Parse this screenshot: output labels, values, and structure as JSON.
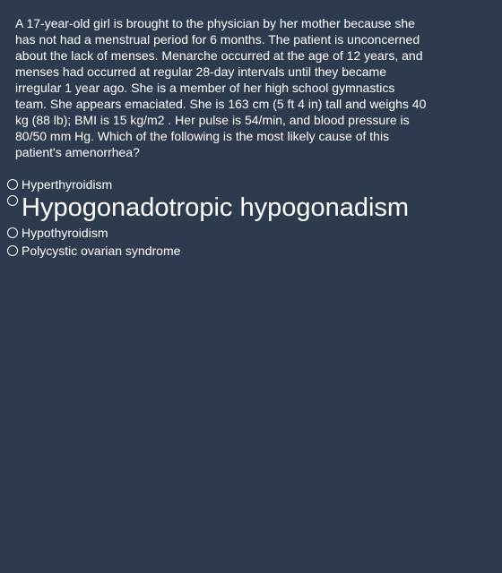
{
  "question": {
    "stem": "A 17-year-old girl is brought to the physician by her mother because she has not had a menstrual period for 6 months. The patient is unconcerned about the lack of menses. Menarche occurred at the age of 12 years, and menses had occurred at regular 28-day intervals until they became irregular 1 year ago. She is a member of her high school gymnastics team. She appears emaciated. She is 163 cm (5 ft 4 in) tall and weighs 40 kg (88 lb); BMI is 15 kg/m2 . Her pulse is 54/min, and blood pressure is 80/50 mm Hg. Which of the following is the most likely cause of this patient's amenorrhea?"
  },
  "options": [
    {
      "label": "Hyperthyroidism"
    },
    {
      "label": "Hypogonadotropic hypogonadism"
    },
    {
      "label": "Hypothyroidism"
    },
    {
      "label": "Polycystic ovarian syndrome"
    }
  ],
  "colors": {
    "background": "#2e3b4e",
    "text": "#ffffff"
  }
}
